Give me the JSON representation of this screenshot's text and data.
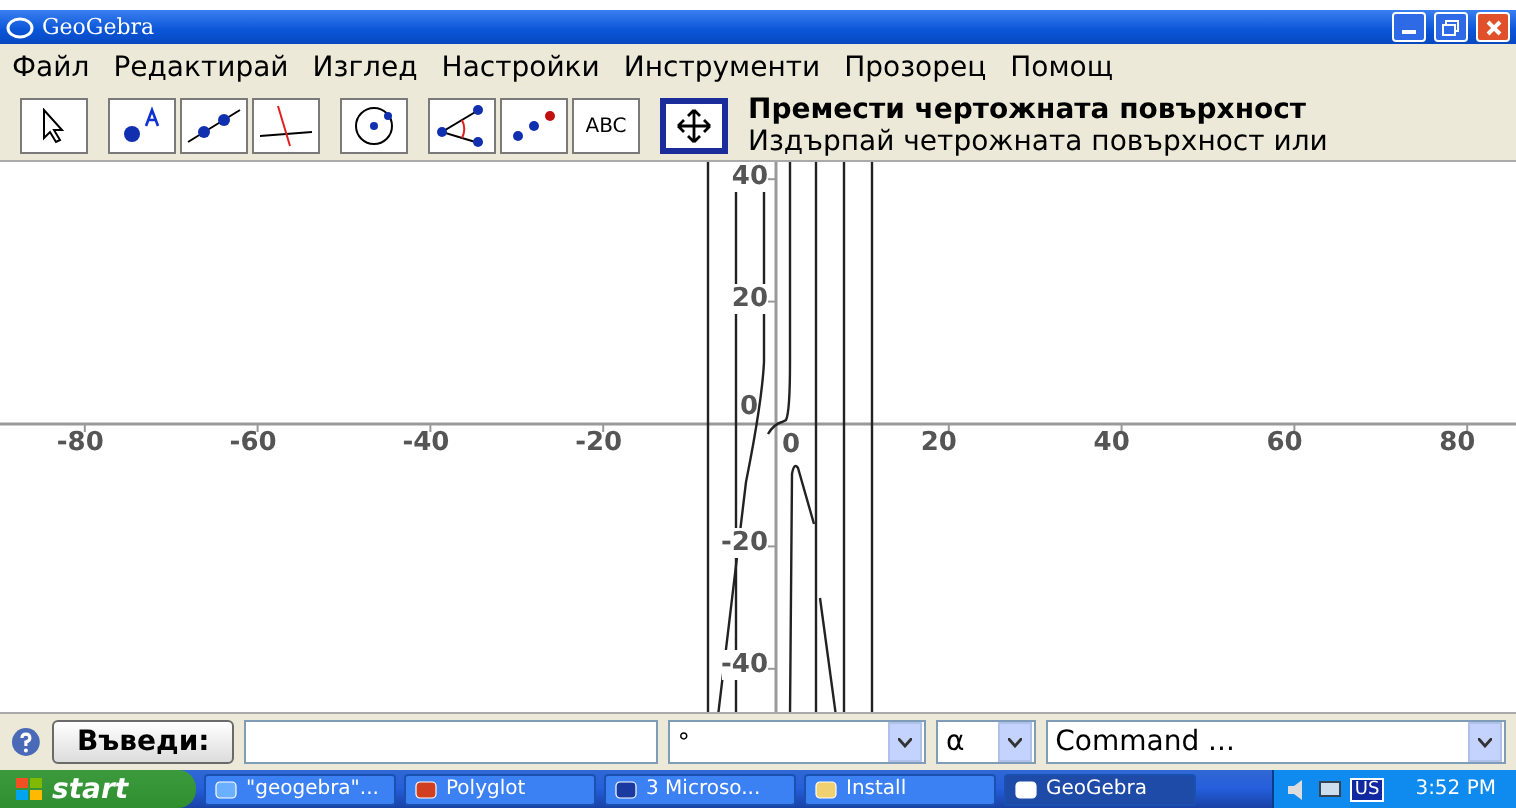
{
  "window": {
    "title": "GeoGebra"
  },
  "menu": [
    "Файл",
    "Редактирай",
    "Изглед",
    "Настройки",
    "Инструменти",
    "Прозорец",
    "Помощ"
  ],
  "tool_groups": [
    [
      {
        "kind": "pointer",
        "selected": false
      }
    ],
    [
      {
        "kind": "point",
        "selected": false
      },
      {
        "kind": "line",
        "selected": false
      },
      {
        "kind": "perpendicular",
        "selected": false
      }
    ],
    [
      {
        "kind": "circle",
        "selected": false
      }
    ],
    [
      {
        "kind": "angle",
        "selected": false
      },
      {
        "kind": "reflect",
        "selected": false
      },
      {
        "kind": "text",
        "label": "ABC",
        "selected": false
      }
    ],
    [
      {
        "kind": "move",
        "selected": true
      }
    ]
  ],
  "tool_help": {
    "title": "Премести чертожната повърхност",
    "description": "Издърпай четрожната повърхност или"
  },
  "graph": {
    "x_ticks": [
      "-80",
      "-60",
      "-40",
      "-20",
      "0",
      "20",
      "40",
      "60",
      "80"
    ],
    "y_ticks": [
      "40",
      "20",
      "0",
      "-20",
      "-40"
    ]
  },
  "input_bar": {
    "button": "Въведи:",
    "symbol_select": "°",
    "greek_select": "α",
    "command_select": "Command ..."
  },
  "taskbar": {
    "start": "start",
    "tasks": [
      {
        "label": "\"geogebra\"...",
        "kind": "browser",
        "selected": false
      },
      {
        "label": "Polyglot",
        "kind": "app",
        "selected": false
      },
      {
        "label": "3 Microso...",
        "kind": "word",
        "selected": false
      },
      {
        "label": "Install",
        "kind": "folder",
        "selected": false
      },
      {
        "label": "GeoGebra",
        "kind": "geogebra",
        "selected": true
      }
    ],
    "language": "US",
    "clock": "3:52 PM"
  }
}
